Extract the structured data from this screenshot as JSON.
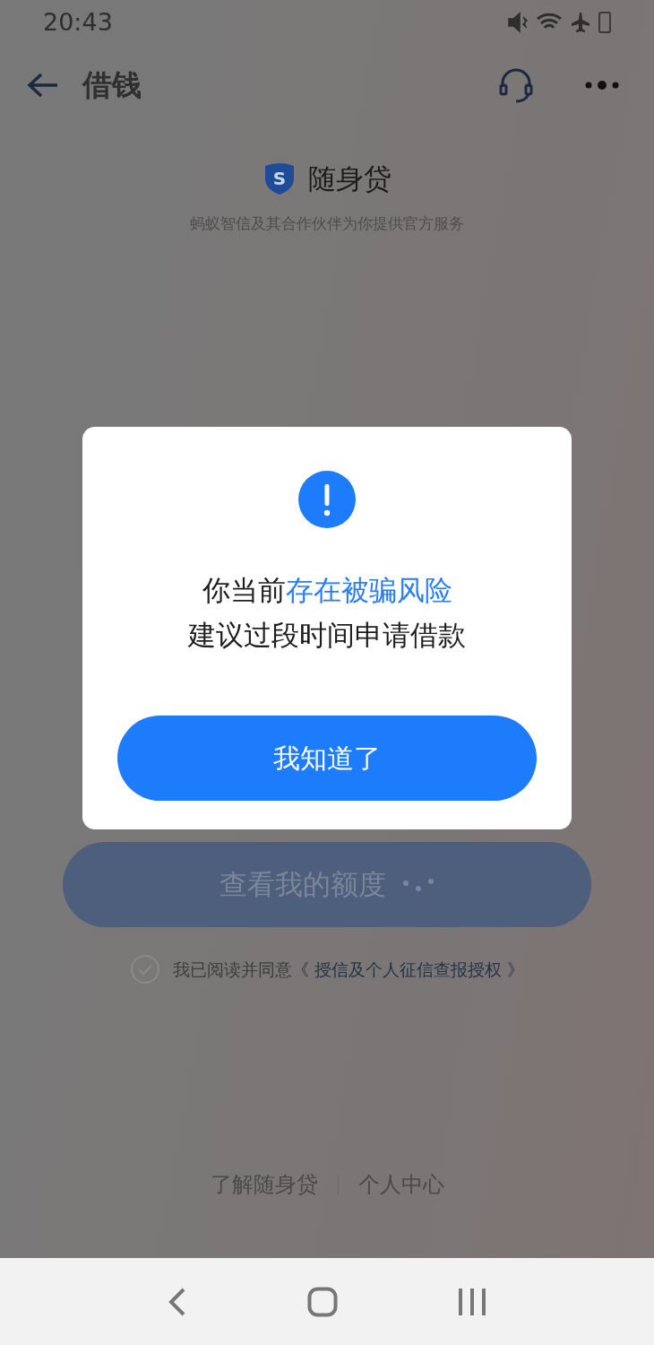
{
  "status_bar": {
    "time": "20:43"
  },
  "header": {
    "title": "借钱"
  },
  "brand": {
    "logo_letter": "S",
    "name": "随身贷",
    "subtitle": "蚂蚁智信及其合作伙伴为你提供官方服务"
  },
  "main_button": {
    "label": "查看我的额度",
    "loading": true
  },
  "agreement": {
    "checked": false,
    "text": "我已阅读并同意",
    "link": "《 授信及个人征信查报授权 》"
  },
  "footer_links": [
    "了解随身贷",
    "个人中心"
  ],
  "dialog": {
    "lines": [
      [
        {
          "text": "你当前",
          "highlight": false
        },
        {
          "text": "存在被骗风险",
          "highlight": true
        }
      ],
      [
        {
          "text": "建议过段时间申请借款",
          "highlight": false
        }
      ]
    ],
    "button": "我知道了"
  }
}
